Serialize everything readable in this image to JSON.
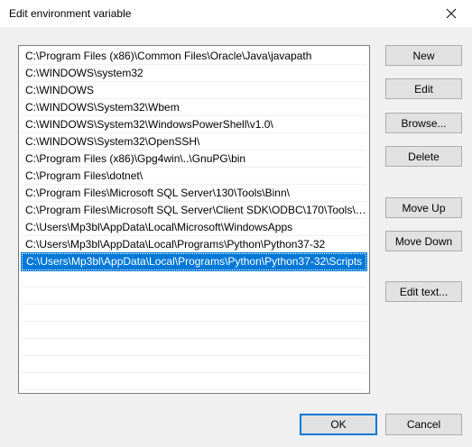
{
  "window": {
    "title": "Edit environment variable"
  },
  "paths": [
    "C:\\Program Files (x86)\\Common Files\\Oracle\\Java\\javapath",
    "C:\\WINDOWS\\system32",
    "C:\\WINDOWS",
    "C:\\WINDOWS\\System32\\Wbem",
    "C:\\WINDOWS\\System32\\WindowsPowerShell\\v1.0\\",
    "C:\\WINDOWS\\System32\\OpenSSH\\",
    "C:\\Program Files (x86)\\Gpg4win\\..\\GnuPG\\bin",
    "C:\\Program Files\\dotnet\\",
    "C:\\Program Files\\Microsoft SQL Server\\130\\Tools\\Binn\\",
    "C:\\Program Files\\Microsoft SQL Server\\Client SDK\\ODBC\\170\\Tools\\Bi...",
    "C:\\Users\\Mp3bl\\AppData\\Local\\Microsoft\\WindowsApps",
    "C:\\Users\\Mp3bl\\AppData\\Local\\Programs\\Python\\Python37-32",
    "C:\\Users\\Mp3bl\\AppData\\Local\\Programs\\Python\\Python37-32\\Scripts"
  ],
  "selected_index": 12,
  "buttons": {
    "new": "New",
    "edit": "Edit",
    "browse": "Browse...",
    "delete": "Delete",
    "move_up": "Move Up",
    "move_down": "Move Down",
    "edit_text": "Edit text...",
    "ok": "OK",
    "cancel": "Cancel"
  },
  "colors": {
    "selection": "#0078d7",
    "dialog_bg": "#f0f0f0"
  },
  "icons": {
    "close": "close-icon"
  }
}
